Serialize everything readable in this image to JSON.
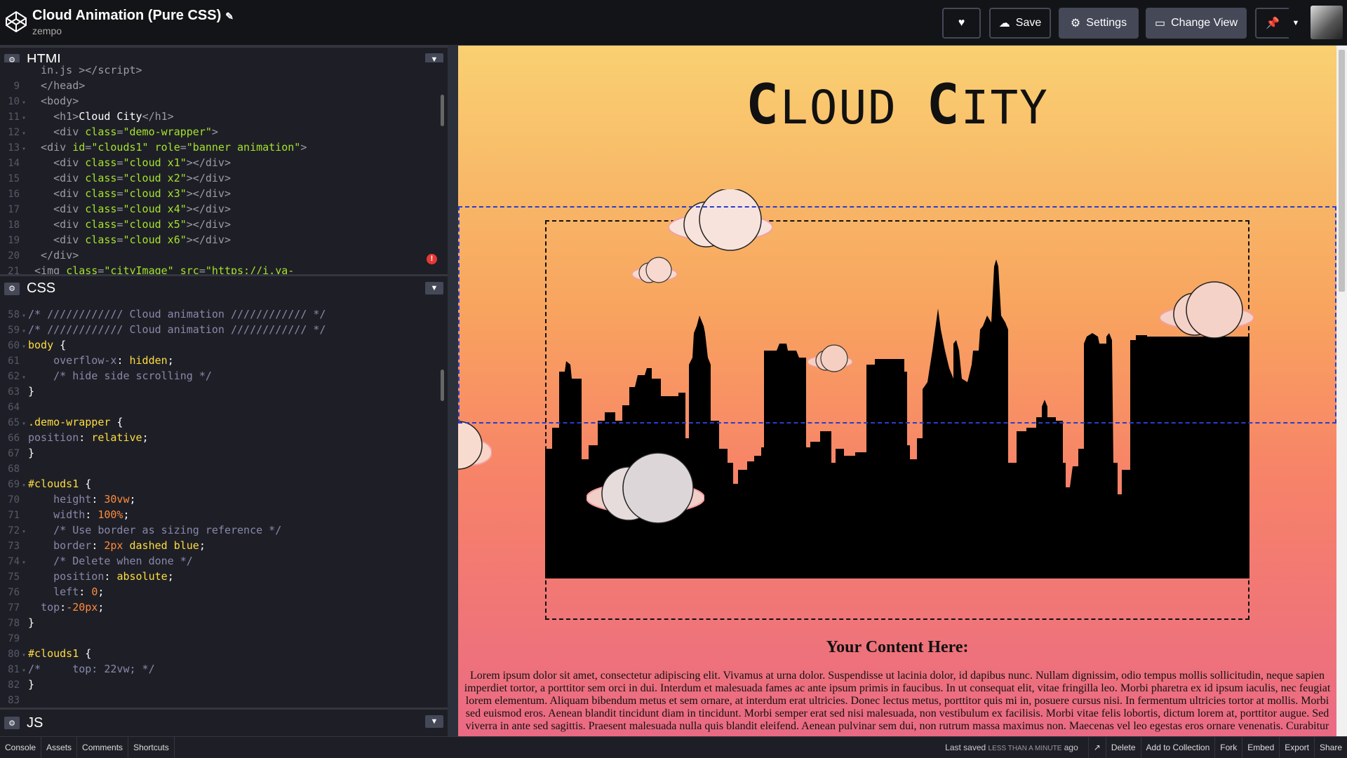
{
  "header": {
    "title": "Cloud Animation (Pure CSS)",
    "author": "zempo",
    "buttons": {
      "save": "Save",
      "settings": "Settings",
      "change_view": "Change View"
    }
  },
  "editors": {
    "html": {
      "label": "HTML",
      "lines": [
        {
          "n": "",
          "fold": "",
          "html": "<span class='tag'>  in.js &gt;&lt;/script&gt;</span>"
        },
        {
          "n": "9",
          "fold": "",
          "html": "<span class='tag'>  &lt;/head&gt;</span>"
        },
        {
          "n": "10",
          "fold": "▾",
          "html": "<span class='tag'>  &lt;body&gt;</span>"
        },
        {
          "n": "11",
          "fold": "▾",
          "html": "<span class='tag'>    &lt;h1&gt;</span><span class='txt'>Cloud City</span><span class='tag'>&lt;/h1&gt;</span>"
        },
        {
          "n": "12",
          "fold": "▾",
          "html": "<span class='tag'>    &lt;div </span><span class='attr'>class</span><span class='tag'>=</span><span class='str'>\"demo-wrapper\"</span><span class='tag'>&gt;</span>"
        },
        {
          "n": "13",
          "fold": "▾",
          "html": "<span class='tag'>  &lt;div </span><span class='attr'>id</span><span class='tag'>=</span><span class='str'>\"clouds1\"</span><span class='tag'> </span><span class='attr'>role</span><span class='tag'>=</span><span class='str'>\"banner animation\"</span><span class='tag'>&gt;</span>"
        },
        {
          "n": "14",
          "fold": "",
          "html": "<span class='tag'>    &lt;div </span><span class='attr'>class</span><span class='tag'>=</span><span class='str'>\"cloud x1\"</span><span class='tag'>&gt;&lt;/div&gt;</span>"
        },
        {
          "n": "15",
          "fold": "",
          "html": "<span class='tag'>    &lt;div </span><span class='attr'>class</span><span class='tag'>=</span><span class='str'>\"cloud x2\"</span><span class='tag'>&gt;&lt;/div&gt;</span>"
        },
        {
          "n": "16",
          "fold": "",
          "html": "<span class='tag'>    &lt;div </span><span class='attr'>class</span><span class='tag'>=</span><span class='str'>\"cloud x3\"</span><span class='tag'>&gt;&lt;/div&gt;</span>"
        },
        {
          "n": "17",
          "fold": "",
          "html": "<span class='tag'>    &lt;div </span><span class='attr'>class</span><span class='tag'>=</span><span class='str'>\"cloud x4\"</span><span class='tag'>&gt;&lt;/div&gt;</span>"
        },
        {
          "n": "18",
          "fold": "",
          "html": "<span class='tag'>    &lt;div </span><span class='attr'>class</span><span class='tag'>=</span><span class='str'>\"cloud x5\"</span><span class='tag'>&gt;&lt;/div&gt;</span>"
        },
        {
          "n": "19",
          "fold": "",
          "html": "<span class='tag'>    &lt;div </span><span class='attr'>class</span><span class='tag'>=</span><span class='str'>\"cloud x6\"</span><span class='tag'>&gt;&lt;/div&gt;</span>"
        },
        {
          "n": "20",
          "fold": "",
          "html": "<span class='tag'>  &lt;/div&gt;</span>"
        },
        {
          "n": "21",
          "fold": "",
          "html": "<span class='tag'> &lt;img </span><span class='attr'>class</span><span class='tag'>=</span><span class='str'>\"cityImage\"</span><span class='tag'> </span><span class='attr'>src</span><span class='tag'>=</span><span class='str'>\"https://i.ya-</span>"
        }
      ]
    },
    "css": {
      "label": "CSS",
      "lines": [
        {
          "n": "58",
          "fold": "▾",
          "html": "<span class='cmt'>/* //////////// Cloud animation //////////// */</span>"
        },
        {
          "n": "59",
          "fold": "▾",
          "html": "<span class='cmt'>/* //////////// Cloud animation //////////// */</span>"
        },
        {
          "n": "60",
          "fold": "▾",
          "html": "<span class='sel'>body</span><span class='txt'> {</span>"
        },
        {
          "n": "61",
          "fold": "",
          "html": "<span class='txt'>    </span><span class='cmt'>overflow-x</span><span class='txt'>: </span><span class='prop'>hidden</span><span class='txt'>;</span>"
        },
        {
          "n": "62",
          "fold": "▾",
          "html": "<span class='txt'>    </span><span class='cmt'>/* hide side scrolling */</span>"
        },
        {
          "n": "63",
          "fold": "",
          "html": "<span class='txt'>}</span>"
        },
        {
          "n": "64",
          "fold": "",
          "html": ""
        },
        {
          "n": "65",
          "fold": "▾",
          "html": "<span class='sel'>.demo-wrapper</span><span class='txt'> {</span>"
        },
        {
          "n": "66",
          "fold": "",
          "html": "<span class='cmt'>position</span><span class='txt'>: </span><span class='prop'>relative</span><span class='txt'>;</span>"
        },
        {
          "n": "67",
          "fold": "",
          "html": "<span class='txt'>}</span>"
        },
        {
          "n": "68",
          "fold": "",
          "html": ""
        },
        {
          "n": "69",
          "fold": "▾",
          "html": "<span class='sel'>#clouds1</span><span class='txt'> {</span>"
        },
        {
          "n": "70",
          "fold": "",
          "html": "<span class='txt'>    </span><span class='cmt'>height</span><span class='txt'>: </span><span class='num'>30vw</span><span class='txt'>;</span>"
        },
        {
          "n": "71",
          "fold": "",
          "html": "<span class='txt'>    </span><span class='cmt'>width</span><span class='txt'>: </span><span class='num'>100%</span><span class='txt'>;</span>"
        },
        {
          "n": "72",
          "fold": "▾",
          "html": "<span class='txt'>    </span><span class='cmt'>/* Use border as sizing reference */</span>"
        },
        {
          "n": "73",
          "fold": "",
          "html": "<span class='txt'>    </span><span class='cmt'>border</span><span class='txt'>: </span><span class='num'>2px</span><span class='prop'> dashed blue</span><span class='txt'>;</span>"
        },
        {
          "n": "74",
          "fold": "▾",
          "html": "<span class='txt'>    </span><span class='cmt'>/* Delete when done */</span>"
        },
        {
          "n": "75",
          "fold": "",
          "html": "<span class='txt'>    </span><span class='cmt'>position</span><span class='txt'>: </span><span class='prop'>absolute</span><span class='txt'>;</span>"
        },
        {
          "n": "76",
          "fold": "",
          "html": "<span class='txt'>    </span><span class='cmt'>left</span><span class='txt'>: </span><span class='num'>0</span><span class='txt'>;</span>"
        },
        {
          "n": "77",
          "fold": "",
          "html": "<span class='txt'>  </span><span class='cmt'>top</span><span class='txt'>:</span><span class='num'>-20px</span><span class='txt'>;</span>"
        },
        {
          "n": "78",
          "fold": "",
          "html": "<span class='txt'>}</span>"
        },
        {
          "n": "79",
          "fold": "",
          "html": ""
        },
        {
          "n": "80",
          "fold": "▾",
          "html": "<span class='sel'>#clouds1</span><span class='txt'> {</span>"
        },
        {
          "n": "81",
          "fold": "▾",
          "html": "<span class='cmt'>/*     top: 22vw; */</span>"
        },
        {
          "n": "82",
          "fold": "",
          "html": "<span class='txt'>}</span>"
        },
        {
          "n": "83",
          "fold": "",
          "html": ""
        }
      ]
    },
    "js": {
      "label": "JS"
    }
  },
  "preview": {
    "heading": {
      "c1": "C",
      "rest1": "LOUD ",
      "c2": "C",
      "rest2": "ITY"
    },
    "content_title": "Your Content Here:",
    "lorem": "Lorem ipsum dolor sit amet, consectetur adipiscing elit. Vivamus at urna dolor. Suspendisse ut lacinia dolor, id dapibus nunc. Nullam dignissim, odio tempus mollis sollicitudin, neque sapien imperdiet tortor, a porttitor sem orci in dui. Interdum et malesuada fames ac ante ipsum primis in faucibus. In ut consequat elit, vitae fringilla leo. Morbi pharetra ex id ipsum iaculis, nec feugiat lorem elementum. Aliquam bibendum metus et sem ornare, at interdum erat ultricies. Donec lectus metus, porttitor quis mi in, posuere cursus nisi. In fermentum ultricies tortor at mollis. Morbi sed euismod eros. Aenean blandit tincidunt diam in tincidunt. Morbi semper erat sed nisi malesuada, non vestibulum ex facilisis. Morbi vitae felis lobortis, dictum lorem at, porttitor augue. Sed viverra in ante sed sagittis. Praesent malesuada nulla quis blandit eleifend. Aenean pulvinar sem dui, non rutrum massa maximus non. Maecenas vel leo egestas eros ornare venenatis. Curabitur"
  },
  "footer": {
    "left": [
      "Console",
      "Assets",
      "Comments",
      "Shortcuts"
    ],
    "saved_prefix": "Last saved",
    "saved_time": "LESS THAN A MINUTE",
    "saved_suffix": "ago",
    "right": [
      "Delete",
      "Add to Collection",
      "Fork",
      "Embed",
      "Export",
      "Share"
    ]
  },
  "colors": {
    "accent_pin": "#47cf73",
    "cloud_border": "#2a3dcc"
  }
}
